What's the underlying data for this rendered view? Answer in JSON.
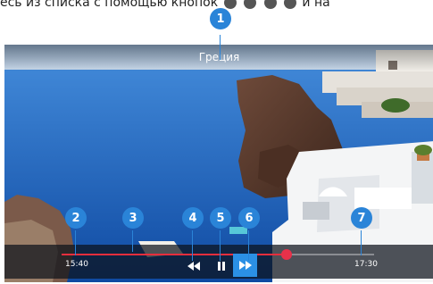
{
  "doc_caption": {
    "text": "есь из списка с помощью кнопок",
    "tail": "и на"
  },
  "player": {
    "title": "Греция",
    "time_start": "15:40",
    "time_end": "17:30",
    "progress": 0.72,
    "buttons": {
      "rewind_icon": "rewind-icon",
      "pause_icon": "pause-icon",
      "forward_icon": "fast-forward-icon"
    },
    "accent_color": "#2b90e5",
    "progress_color": "#e62e3d"
  },
  "callouts": [
    "1",
    "2",
    "3",
    "4",
    "5",
    "6",
    "7"
  ]
}
